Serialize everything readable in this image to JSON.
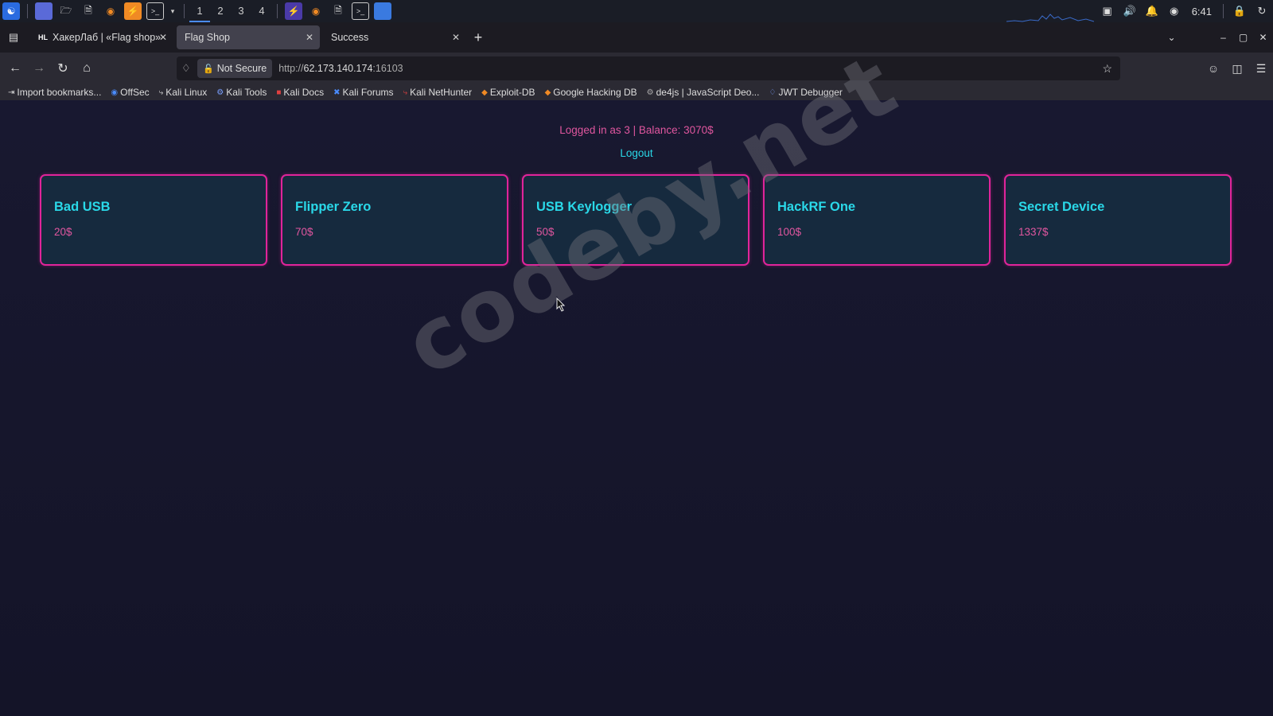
{
  "taskbar": {
    "workspaces": [
      "1",
      "2",
      "3",
      "4"
    ],
    "clock": "6:41"
  },
  "browser": {
    "tabs": [
      {
        "favicon": "HL",
        "label": "ХакерЛаб | «Flag shop»"
      },
      {
        "label": "Flag Shop"
      },
      {
        "label": "Success"
      }
    ],
    "not_secure_label": "Not Secure",
    "url_prefix": "http://",
    "url_host": "62.173.140.174",
    "url_port": ":16103",
    "bookmarks": [
      "Import bookmarks...",
      "OffSec",
      "Kali Linux",
      "Kali Tools",
      "Kali Docs",
      "Kali Forums",
      "Kali NetHunter",
      "Exploit-DB",
      "Google Hacking DB",
      "de4js | JavaScript Deo...",
      "JWT Debugger"
    ]
  },
  "shop": {
    "status": "Logged in as 3 | Balance: 3070$",
    "logout": "Logout",
    "products": [
      {
        "name": "Bad USB",
        "price": "20$"
      },
      {
        "name": "Flipper Zero",
        "price": "70$"
      },
      {
        "name": "USB Keylogger",
        "price": "50$"
      },
      {
        "name": "HackRF One",
        "price": "100$"
      },
      {
        "name": "Secret Device",
        "price": "1337$"
      }
    ]
  },
  "watermark": "codeby.net",
  "colors": {
    "accent_pink": "#e0249a",
    "accent_cyan": "#2ad8e8",
    "page_bg": "#15152a"
  }
}
